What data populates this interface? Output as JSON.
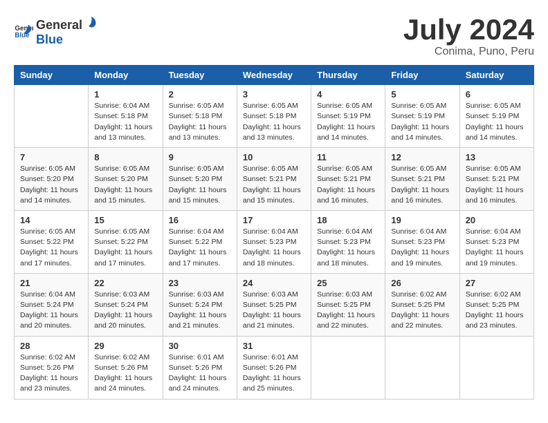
{
  "header": {
    "logo_general": "General",
    "logo_blue": "Blue",
    "month": "July 2024",
    "location": "Conima, Puno, Peru"
  },
  "weekdays": [
    "Sunday",
    "Monday",
    "Tuesday",
    "Wednesday",
    "Thursday",
    "Friday",
    "Saturday"
  ],
  "weeks": [
    [
      {
        "day": "",
        "info": ""
      },
      {
        "day": "1",
        "info": "Sunrise: 6:04 AM\nSunset: 5:18 PM\nDaylight: 11 hours\nand 13 minutes."
      },
      {
        "day": "2",
        "info": "Sunrise: 6:05 AM\nSunset: 5:18 PM\nDaylight: 11 hours\nand 13 minutes."
      },
      {
        "day": "3",
        "info": "Sunrise: 6:05 AM\nSunset: 5:18 PM\nDaylight: 11 hours\nand 13 minutes."
      },
      {
        "day": "4",
        "info": "Sunrise: 6:05 AM\nSunset: 5:19 PM\nDaylight: 11 hours\nand 14 minutes."
      },
      {
        "day": "5",
        "info": "Sunrise: 6:05 AM\nSunset: 5:19 PM\nDaylight: 11 hours\nand 14 minutes."
      },
      {
        "day": "6",
        "info": "Sunrise: 6:05 AM\nSunset: 5:19 PM\nDaylight: 11 hours\nand 14 minutes."
      }
    ],
    [
      {
        "day": "7",
        "info": "Sunrise: 6:05 AM\nSunset: 5:20 PM\nDaylight: 11 hours\nand 14 minutes."
      },
      {
        "day": "8",
        "info": "Sunrise: 6:05 AM\nSunset: 5:20 PM\nDaylight: 11 hours\nand 15 minutes."
      },
      {
        "day": "9",
        "info": "Sunrise: 6:05 AM\nSunset: 5:20 PM\nDaylight: 11 hours\nand 15 minutes."
      },
      {
        "day": "10",
        "info": "Sunrise: 6:05 AM\nSunset: 5:21 PM\nDaylight: 11 hours\nand 15 minutes."
      },
      {
        "day": "11",
        "info": "Sunrise: 6:05 AM\nSunset: 5:21 PM\nDaylight: 11 hours\nand 16 minutes."
      },
      {
        "day": "12",
        "info": "Sunrise: 6:05 AM\nSunset: 5:21 PM\nDaylight: 11 hours\nand 16 minutes."
      },
      {
        "day": "13",
        "info": "Sunrise: 6:05 AM\nSunset: 5:21 PM\nDaylight: 11 hours\nand 16 minutes."
      }
    ],
    [
      {
        "day": "14",
        "info": "Sunrise: 6:05 AM\nSunset: 5:22 PM\nDaylight: 11 hours\nand 17 minutes."
      },
      {
        "day": "15",
        "info": "Sunrise: 6:05 AM\nSunset: 5:22 PM\nDaylight: 11 hours\nand 17 minutes."
      },
      {
        "day": "16",
        "info": "Sunrise: 6:04 AM\nSunset: 5:22 PM\nDaylight: 11 hours\nand 17 minutes."
      },
      {
        "day": "17",
        "info": "Sunrise: 6:04 AM\nSunset: 5:23 PM\nDaylight: 11 hours\nand 18 minutes."
      },
      {
        "day": "18",
        "info": "Sunrise: 6:04 AM\nSunset: 5:23 PM\nDaylight: 11 hours\nand 18 minutes."
      },
      {
        "day": "19",
        "info": "Sunrise: 6:04 AM\nSunset: 5:23 PM\nDaylight: 11 hours\nand 19 minutes."
      },
      {
        "day": "20",
        "info": "Sunrise: 6:04 AM\nSunset: 5:23 PM\nDaylight: 11 hours\nand 19 minutes."
      }
    ],
    [
      {
        "day": "21",
        "info": "Sunrise: 6:04 AM\nSunset: 5:24 PM\nDaylight: 11 hours\nand 20 minutes."
      },
      {
        "day": "22",
        "info": "Sunrise: 6:03 AM\nSunset: 5:24 PM\nDaylight: 11 hours\nand 20 minutes."
      },
      {
        "day": "23",
        "info": "Sunrise: 6:03 AM\nSunset: 5:24 PM\nDaylight: 11 hours\nand 21 minutes."
      },
      {
        "day": "24",
        "info": "Sunrise: 6:03 AM\nSunset: 5:25 PM\nDaylight: 11 hours\nand 21 minutes."
      },
      {
        "day": "25",
        "info": "Sunrise: 6:03 AM\nSunset: 5:25 PM\nDaylight: 11 hours\nand 22 minutes."
      },
      {
        "day": "26",
        "info": "Sunrise: 6:02 AM\nSunset: 5:25 PM\nDaylight: 11 hours\nand 22 minutes."
      },
      {
        "day": "27",
        "info": "Sunrise: 6:02 AM\nSunset: 5:25 PM\nDaylight: 11 hours\nand 23 minutes."
      }
    ],
    [
      {
        "day": "28",
        "info": "Sunrise: 6:02 AM\nSunset: 5:26 PM\nDaylight: 11 hours\nand 23 minutes."
      },
      {
        "day": "29",
        "info": "Sunrise: 6:02 AM\nSunset: 5:26 PM\nDaylight: 11 hours\nand 24 minutes."
      },
      {
        "day": "30",
        "info": "Sunrise: 6:01 AM\nSunset: 5:26 PM\nDaylight: 11 hours\nand 24 minutes."
      },
      {
        "day": "31",
        "info": "Sunrise: 6:01 AM\nSunset: 5:26 PM\nDaylight: 11 hours\nand 25 minutes."
      },
      {
        "day": "",
        "info": ""
      },
      {
        "day": "",
        "info": ""
      },
      {
        "day": "",
        "info": ""
      }
    ]
  ]
}
